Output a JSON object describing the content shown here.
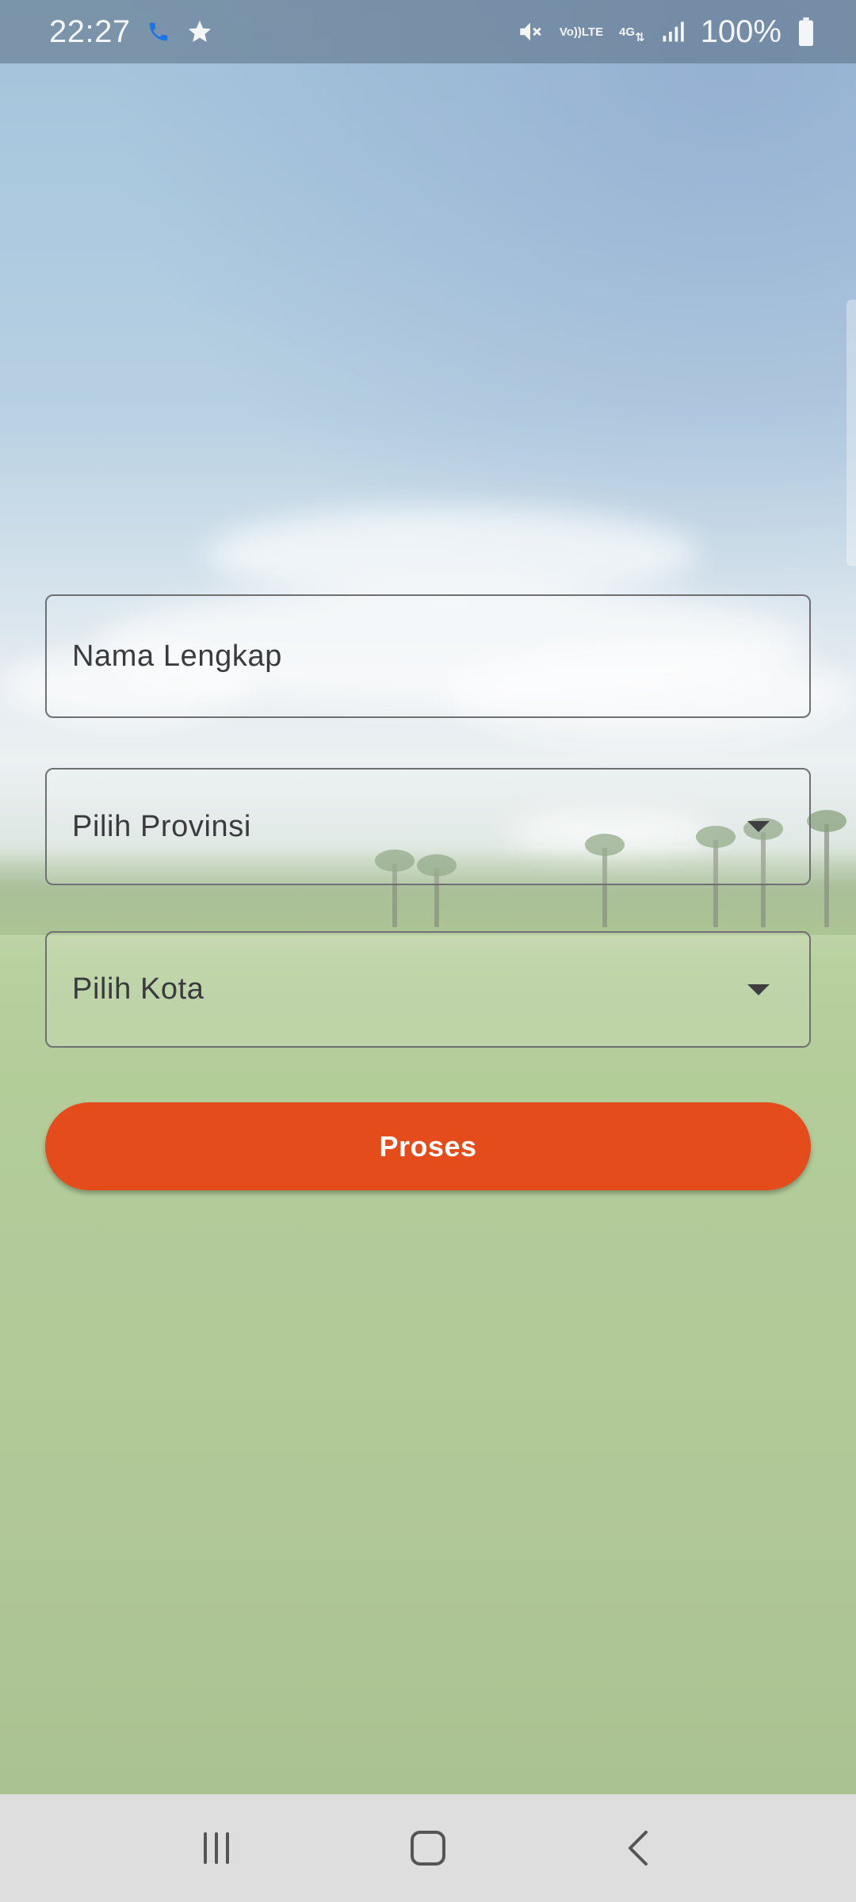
{
  "status_bar": {
    "time": "22:27",
    "battery": "100%",
    "network_top": "Vo))",
    "network_bottom": "LTE",
    "network_type": "4G",
    "icons": [
      "call-icon",
      "star-icon",
      "mute-icon",
      "volte-icon",
      "data-4g-icon",
      "signal-icon",
      "battery-icon"
    ]
  },
  "form": {
    "name_field": {
      "placeholder": "Nama Lengkap",
      "value": ""
    },
    "province_select": {
      "placeholder": "Pilih Provinsi",
      "value": ""
    },
    "city_select": {
      "placeholder": "Pilih Kota",
      "value": ""
    },
    "submit_label": "Proses"
  },
  "colors": {
    "accent": "#e44d1b",
    "call_icon": "#1a73e8"
  },
  "nav_bar": {
    "buttons": [
      "recents-icon",
      "home-icon",
      "back-icon"
    ]
  }
}
